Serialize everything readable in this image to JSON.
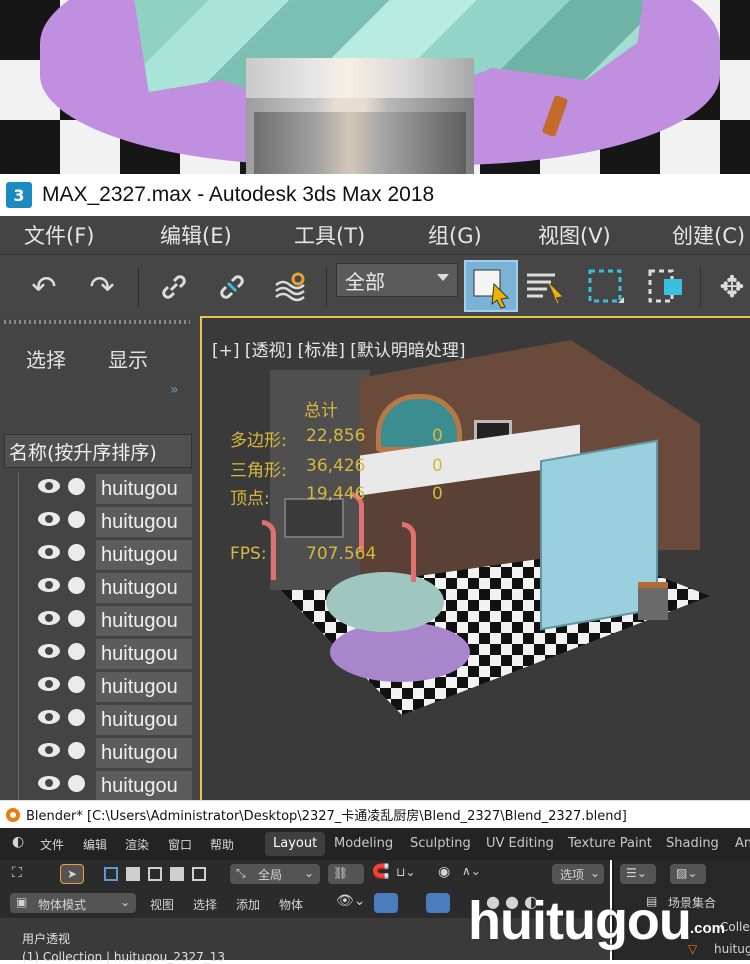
{
  "max": {
    "title": "MAX_2327.max - Autodesk 3ds Max 2018",
    "logo": "3",
    "menu": [
      "文件(F)",
      "编辑(E)",
      "工具(T)",
      "组(G)",
      "视图(V)",
      "创建(C)"
    ],
    "selection_filter": "全部",
    "panel_tabs": [
      "选择",
      "显示"
    ],
    "panel_chevron": "»",
    "column_header": "名称(按升序排序)",
    "objects": [
      "huitugou",
      "huitugou",
      "huitugou",
      "huitugou",
      "huitugou",
      "huitugou",
      "huitugou",
      "huitugou",
      "huitugou",
      "huitugou"
    ],
    "viewport_label": "[+] [透视] [标准] [默认明暗处理]",
    "stats": {
      "total_label": "总计",
      "polys_label": "多边形:",
      "polys_value": "22,856",
      "polys_sel": "0",
      "tris_label": "三角形:",
      "tris_value": "36,426",
      "tris_sel": "0",
      "verts_label": "顶点:",
      "verts_value": "19,446",
      "verts_sel": "0",
      "fps_label": "FPS:",
      "fps_value": "707.564"
    }
  },
  "blender": {
    "title": "Blender* [C:\\Users\\Administrator\\Desktop\\2327_卡通凌乱厨房\\Blend_2327\\Blend_2327.blend]",
    "menu": [
      "文件",
      "编辑",
      "渲染",
      "窗口",
      "帮助"
    ],
    "workspaces": [
      "Layout",
      "Modeling",
      "Sculpting",
      "UV Editing",
      "Texture Paint",
      "Shading",
      "An"
    ],
    "transform": "全局",
    "options": "选项",
    "mode": "物体模式",
    "header_menu": [
      "视图",
      "选择",
      "添加",
      "物体"
    ],
    "viewport_label": "用户透视",
    "viewport_collection": "(1) Collection | huitugou_2327_13",
    "outliner_title": "场景集合",
    "outliner_item1": "Collec",
    "outliner_item2": "huitug",
    "watermark": "huitugou",
    "watermark_suffix": ".com"
  },
  "colors": {
    "stats_text": "#d6b73f",
    "viewport_border": "#e8c44a",
    "active_select": "#7bb3d6",
    "blender_accent": "#e87d0d"
  }
}
